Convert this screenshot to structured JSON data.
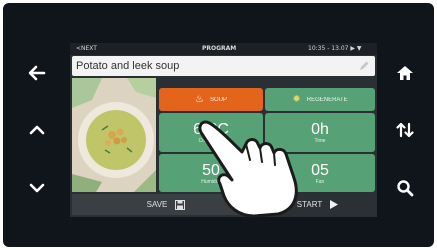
{
  "status_bar": {
    "left": "<NEXT",
    "title": "PROGRAM",
    "right": "10:35 - 13.07 ▶ ▼"
  },
  "recipe": {
    "name": "Potato and leek soup"
  },
  "tiles": {
    "category_label": "SOUP",
    "category2_label": "REGENERATE",
    "temperature_value": "63°C",
    "temperature_label": "Core probe",
    "time_value": "0h",
    "time_label": "Time",
    "humidity_value": "50",
    "humidity_label": "Humidity",
    "fan_value": "05",
    "fan_label": "Fan"
  },
  "footer": {
    "save_label": "SAVE",
    "start_label": "START"
  },
  "icons": {
    "back": "arrow-left-icon",
    "up": "chevron-up-icon",
    "down": "chevron-down-icon",
    "home": "home-icon",
    "sort": "sort-arrows-icon",
    "search": "search-icon"
  },
  "colors": {
    "accent_green": "#57a176",
    "accent_orange": "#e5641b",
    "bezel": "#10151b"
  }
}
